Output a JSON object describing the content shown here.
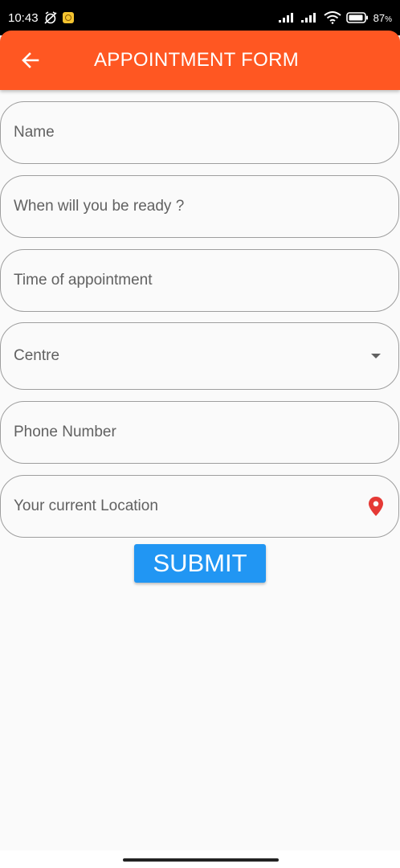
{
  "status_bar": {
    "time": "10:43",
    "battery_percent": "87",
    "battery_suffix": "%"
  },
  "app_bar": {
    "title": "APPOINTMENT FORM",
    "color": "#ff5722"
  },
  "form": {
    "name_placeholder": "Name",
    "ready_placeholder": "When will you be ready ?",
    "time_placeholder": "Time of appointment",
    "centre_label": "Centre",
    "phone_placeholder": "Phone Number",
    "location_placeholder": "Your current Location",
    "submit_label": "SUBMIT",
    "submit_color": "#2196f3",
    "location_icon_color": "#e53935"
  }
}
